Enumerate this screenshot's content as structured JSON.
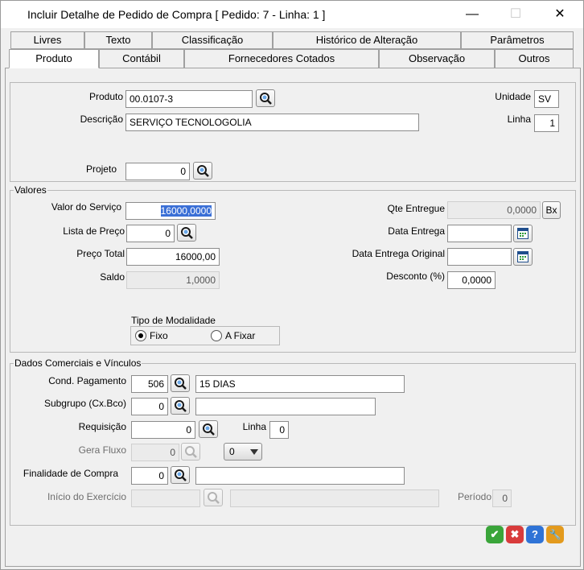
{
  "window": {
    "title": "Incluir Detalhe de Pedido de Compra [ Pedido: 7  -  Linha: 1 ]",
    "minimize_glyph": "—",
    "maximize_glyph": "☐",
    "close_glyph": "✕"
  },
  "tabs": {
    "row1": [
      "Livres",
      "Texto",
      "Classificação",
      "Histórico de Alteração",
      "Parâmetros"
    ],
    "row2": [
      "Produto",
      "Contábil",
      "Fornecedores Cotados",
      "Observação",
      "Outros"
    ],
    "active": "Produto"
  },
  "produto": {
    "produto_label": "Produto",
    "produto_value": "00.0107-3",
    "descricao_label": "Descrição",
    "descricao_value": "SERVIÇO TECNOLOGOLIA",
    "unidade_label": "Unidade",
    "unidade_value": "SV",
    "linha_label": "Linha",
    "linha_value": "1",
    "projeto_label": "Projeto",
    "projeto_value": "0"
  },
  "valores": {
    "title": "Valores",
    "valor_servico_label": "Valor do Serviço",
    "valor_servico_value": "16000,0000",
    "lista_preco_label": "Lista de Preço",
    "lista_preco_value": "0",
    "preco_total_label": "Preço Total",
    "preco_total_value": "16000,00",
    "saldo_label": "Saldo",
    "saldo_value": "1,0000",
    "qte_entregue_label": "Qte Entregue",
    "qte_entregue_value": "0,0000",
    "bx_label": "Bx",
    "data_entrega_label": "Data Entrega",
    "data_entrega_value": "",
    "data_entrega_original_label": "Data Entrega Original",
    "data_entrega_original_value": "",
    "desconto_label": "Desconto (%)",
    "desconto_value": "0,0000",
    "modalidade_title": "Tipo de Modalidade",
    "modalidade_options": [
      "Fixo",
      "A Fixar"
    ],
    "modalidade_selected": "Fixo"
  },
  "dados": {
    "title": "Dados Comerciais e Vínculos",
    "cond_pagamento_label": "Cond. Pagamento",
    "cond_pagamento_code": "506",
    "cond_pagamento_desc": "15 DIAS",
    "subgrupo_label": "Subgrupo (Cx.Bco)",
    "subgrupo_code": "0",
    "subgrupo_desc": "",
    "requisicao_label": "Requisição",
    "requisicao_value": "0",
    "req_linha_label": "Linha",
    "req_linha_value": "0",
    "gera_fluxo_label": "Gera Fluxo",
    "gera_fluxo_value": "0",
    "gera_fluxo_combo": "0",
    "finalidade_label": "Finalidade de Compra",
    "finalidade_code": "0",
    "finalidade_desc": "",
    "inicio_exercicio_label": "Início do Exercício",
    "inicio_exercicio_value": "",
    "inicio_exercicio_desc": "",
    "periodo_label": "Período",
    "periodo_value": "0"
  },
  "actions": {
    "ok_glyph": "✔",
    "cancel_glyph": "✖",
    "help_glyph": "?",
    "tools_glyph": "🔧"
  },
  "colors": {
    "ok": "#3aa53a",
    "cancel": "#d83b3b",
    "help": "#2f73d6",
    "tools": "#e39a1d",
    "selection": "#3a6fd6"
  }
}
